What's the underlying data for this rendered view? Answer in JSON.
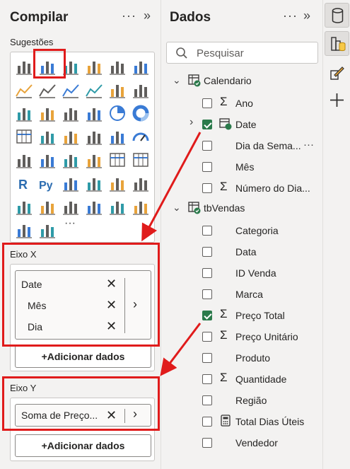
{
  "build_pane": {
    "title": "Compilar",
    "more_label": "···",
    "collapse_label": "»",
    "suggestions_label": "Sugestões",
    "gallery_more_label": "···",
    "x_axis": {
      "label": "Eixo X",
      "fields": [
        "Date",
        "Mês",
        "Dia"
      ],
      "add_label": "+Adicionar dados"
    },
    "y_axis": {
      "label": "Eixo Y",
      "fields": [
        "Soma de Preço..."
      ],
      "add_label": "+Adicionar dados"
    }
  },
  "data_pane": {
    "title": "Dados",
    "more_label": "···",
    "collapse_label": "»",
    "search_placeholder": "Pesquisar",
    "tables": [
      {
        "name": "Calendario",
        "fields": [
          {
            "name": "Ano",
            "sigma": true,
            "checked": false
          },
          {
            "name": "Date",
            "hierarchy": true,
            "checked": true,
            "expandable": true
          },
          {
            "name": "Dia da Sema...",
            "checked": false,
            "more": true
          },
          {
            "name": "Mês",
            "checked": false
          },
          {
            "name": "Número do Dia...",
            "sigma": true,
            "checked": false
          }
        ]
      },
      {
        "name": "tbVendas",
        "fields": [
          {
            "name": "Categoria",
            "checked": false
          },
          {
            "name": "Data",
            "checked": false
          },
          {
            "name": "ID Venda",
            "checked": false
          },
          {
            "name": "Marca",
            "checked": false
          },
          {
            "name": "Preço Total",
            "sigma": true,
            "checked": true
          },
          {
            "name": "Preço Unitário",
            "sigma": true,
            "checked": false
          },
          {
            "name": "Produto",
            "checked": false
          },
          {
            "name": "Quantidade",
            "sigma": true,
            "checked": false
          },
          {
            "name": "Região",
            "checked": false
          },
          {
            "name": "Total Dias Úteis",
            "calc": true,
            "checked": false
          },
          {
            "name": "Vendedor",
            "checked": false
          }
        ]
      }
    ]
  },
  "rail": {
    "buttons": [
      "data-cylinder-icon",
      "build-visual-icon",
      "format-brush-icon",
      "add-icon"
    ]
  },
  "colors": {
    "highlight": "#e01b1b",
    "check": "#2b7a4b"
  }
}
